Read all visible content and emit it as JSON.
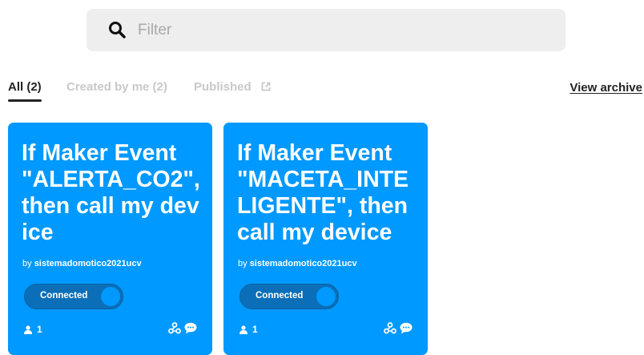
{
  "search": {
    "placeholder": "Filter"
  },
  "tabs": [
    {
      "label": "All (2)",
      "active": true
    },
    {
      "label": "Created by me (2)",
      "active": false
    },
    {
      "label": "Published",
      "active": false
    }
  ],
  "view_archive_label": "View archive",
  "cards": [
    {
      "title": "If Maker Event \"ALERTA_CO2\", then call my device",
      "by_prefix": "by",
      "author": "sistemadomotico2021ucv",
      "status": "Connected",
      "users": "1"
    },
    {
      "title": "If Maker Event \"MACETA_INTELIGENTE\", then call my device",
      "by_prefix": "by",
      "author": "sistemadomotico2021ucv",
      "status": "Connected",
      "users": "1"
    }
  ],
  "colors": {
    "card": "#0099ff",
    "toggle": "#0a6fb8",
    "muted_tab": "#c9c9c9"
  },
  "icons": {
    "search": "search-icon",
    "external": "external-link-icon",
    "user": "user-icon",
    "webhooks": "webhooks-icon",
    "chat": "chat-bubble-icon"
  }
}
